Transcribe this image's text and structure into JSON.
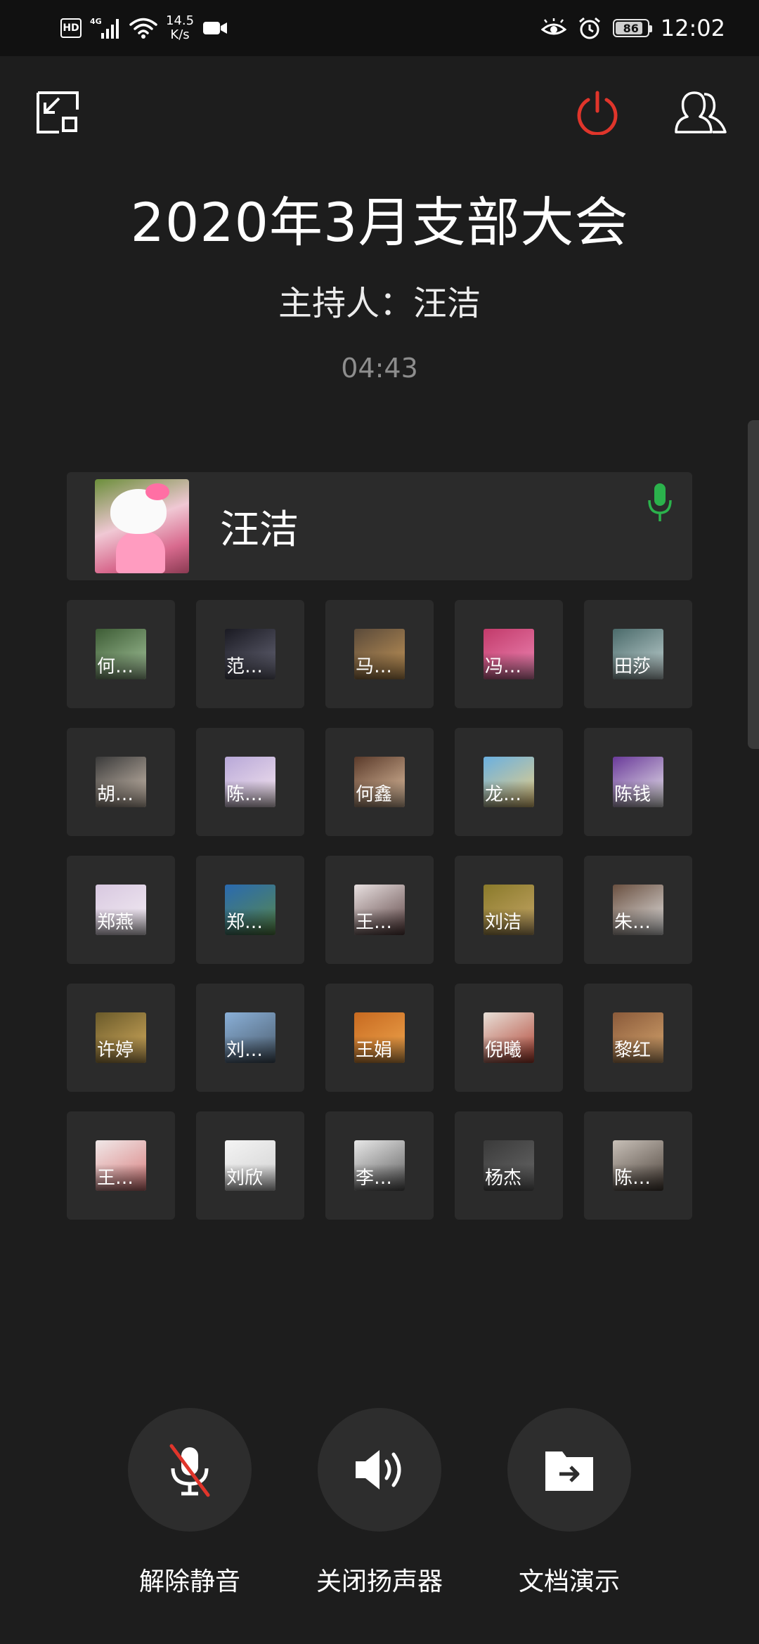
{
  "status_bar": {
    "hd": "HD",
    "network": "4G",
    "speed_value": "14.5",
    "speed_unit": "K/s",
    "battery_level": "86",
    "battery_percent": 86,
    "time": "12:02",
    "icons": [
      "hd-icon",
      "signal-icon",
      "wifi-icon",
      "video-recording-icon",
      "eye-care-icon",
      "alarm-icon",
      "battery-icon"
    ]
  },
  "toolbar": {
    "minimize_icon": "minimize-window-icon",
    "end_meeting_icon": "power-icon",
    "participants_icon": "participants-icon",
    "end_color": "#e0352b"
  },
  "meeting": {
    "title": "2020年3月支部大会",
    "host_line": "主持人：汪洁",
    "elapsed": "04:43"
  },
  "speaker": {
    "name": "汪洁",
    "mic_icon": "microphone-active-icon",
    "mic_color": "#2bb24c"
  },
  "participants": [
    {
      "name": "何…",
      "colors": [
        "#3d5c35",
        "#a9c9a0"
      ]
    },
    {
      "name": "范…",
      "colors": [
        "#1a1a22",
        "#6b6b7c"
      ]
    },
    {
      "name": "马…",
      "colors": [
        "#5a4a3a",
        "#c99a5a"
      ]
    },
    {
      "name": "冯…",
      "colors": [
        "#c23a6a",
        "#f08ab8"
      ]
    },
    {
      "name": "田莎",
      "colors": [
        "#4a6a6a",
        "#c8d8d8"
      ]
    },
    {
      "name": "胡…",
      "colors": [
        "#3a3a3a",
        "#d8c8b8"
      ]
    },
    {
      "name": "陈…",
      "colors": [
        "#b8a8d8",
        "#f8e8f0"
      ]
    },
    {
      "name": "何鑫",
      "colors": [
        "#5a3a2a",
        "#e8c8a8"
      ]
    },
    {
      "name": "龙…",
      "colors": [
        "#6ab0e0",
        "#f0d080"
      ]
    },
    {
      "name": "陈钱",
      "colors": [
        "#6a3a9a",
        "#f0f0f0"
      ]
    },
    {
      "name": "郑燕",
      "colors": [
        "#d8c8e0",
        "#f4eef4"
      ]
    },
    {
      "name": "郑…",
      "colors": [
        "#2a6ab0",
        "#5a8a4a"
      ]
    },
    {
      "name": "王…",
      "colors": [
        "#e8e0e0",
        "#5a4040"
      ]
    },
    {
      "name": "刘洁",
      "colors": [
        "#8a7a2a",
        "#c8a86a"
      ]
    },
    {
      "name": "朱…",
      "colors": [
        "#6a5040",
        "#e8e8e8"
      ]
    },
    {
      "name": "许婷",
      "colors": [
        "#6a5a2a",
        "#d8b060"
      ]
    },
    {
      "name": "刘…",
      "colors": [
        "#8ab0d8",
        "#4a5a6a"
      ]
    },
    {
      "name": "王娟",
      "colors": [
        "#c86a20",
        "#f0a850"
      ]
    },
    {
      "name": "倪曦",
      "colors": [
        "#e8e0d8",
        "#b04030"
      ]
    },
    {
      "name": "黎红",
      "colors": [
        "#8a5a3a",
        "#d8a870"
      ]
    },
    {
      "name": "王…",
      "colors": [
        "#f0e8e8",
        "#d87a7a"
      ]
    },
    {
      "name": "刘欣",
      "colors": [
        "#f4f4f4",
        "#d0d0d0"
      ]
    },
    {
      "name": "李…",
      "colors": [
        "#e8e8e8",
        "#5a5a5a"
      ]
    },
    {
      "name": "杨杰",
      "colors": [
        "#3a3a3a",
        "#6a6a6a"
      ]
    },
    {
      "name": "陈…",
      "colors": [
        "#c8c0b8",
        "#4a4038"
      ]
    }
  ],
  "controls": {
    "unmute": {
      "label": "解除静音",
      "icon": "microphone-muted-icon",
      "slash_color": "#e0352b"
    },
    "speaker": {
      "label": "关闭扬声器",
      "icon": "speaker-icon"
    },
    "present": {
      "label": "文档演示",
      "icon": "document-share-icon"
    }
  }
}
